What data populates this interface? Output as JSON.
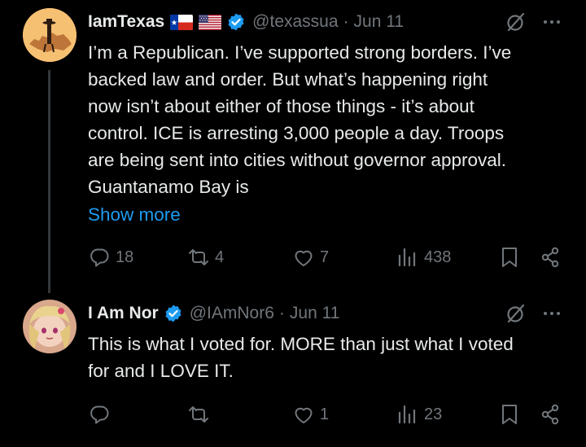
{
  "tweets": [
    {
      "name": "IamTexas",
      "flags": [
        "texas-flag",
        "us-flag"
      ],
      "handle": "@texassua",
      "separator": "·",
      "date": "Jun 11",
      "text_lines": [
        "I’m a Republican. I’ve supported strong borders. I’ve",
        "backed law and order. But what’s happening right",
        "now isn’t about either of those things - it’s about",
        "control. ICE is arresting 3,000 people a day. Troops",
        "are being sent into cities without governor approval.",
        "Guantanamo Bay is"
      ],
      "show_more": "Show more",
      "replies": "18",
      "retweets": "4",
      "likes": "7",
      "views": "438"
    },
    {
      "name": "I Am Nor",
      "handle": "@IAmNor6",
      "separator": "·",
      "date": "Jun 11",
      "text_lines": [
        "This is what I voted for. MORE than just what I voted",
        "for and I LOVE IT."
      ],
      "replies": "",
      "retweets": "",
      "likes": "1",
      "views": "23"
    }
  ],
  "colors": {
    "background": "#000000",
    "text": "#e7e9ea",
    "muted": "#71767b",
    "link": "#1d9bf0",
    "verified": "#1d9bf0"
  },
  "icons": [
    "grok-icon",
    "more-icon",
    "reply-icon",
    "retweet-icon",
    "like-icon",
    "views-icon",
    "bookmark-icon",
    "share-icon",
    "verified-badge-icon"
  ]
}
